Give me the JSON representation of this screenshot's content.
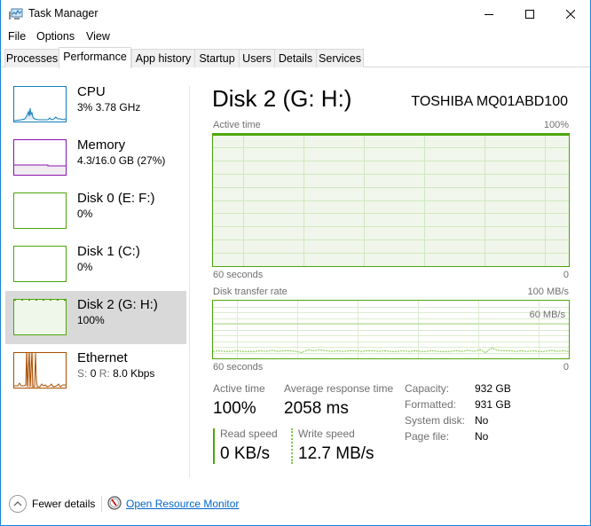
{
  "window": {
    "title": "Task Manager",
    "controls": {
      "minimize": "minimize",
      "maximize": "maximize",
      "close": "close"
    }
  },
  "menu": [
    "File",
    "Options",
    "View"
  ],
  "tabs": [
    {
      "label": "Processes",
      "active": false
    },
    {
      "label": "Performance",
      "active": true
    },
    {
      "label": "App history",
      "active": false
    },
    {
      "label": "Startup",
      "active": false
    },
    {
      "label": "Users",
      "active": false
    },
    {
      "label": "Details",
      "active": false
    },
    {
      "label": "Services",
      "active": false
    }
  ],
  "sidebar": {
    "items": [
      {
        "title": "CPU",
        "sub": "3%  3.78 GHz",
        "color": "#117dbb",
        "fill": "#f1f6fa",
        "selected": false
      },
      {
        "title": "Memory",
        "sub": "4.3/16.0 GB (27%)",
        "color": "#8b12ae",
        "fill": "#f4f2f4",
        "selected": false
      },
      {
        "title": "Disk 0 (E: F:)",
        "sub": "0%",
        "color": "#4da60c",
        "fill": "#ffffff",
        "selected": false
      },
      {
        "title": "Disk 1 (C:)",
        "sub": "0%",
        "color": "#4da60c",
        "fill": "#ffffff",
        "selected": false
      },
      {
        "title": "Disk 2 (G: H:)",
        "sub": "100%",
        "color": "#4da60c",
        "fill": "#eff6ea",
        "selected": true
      },
      {
        "title": "Ethernet",
        "sub_s_label": "S:",
        "sub_s_val": "0",
        "sub_r_label": "R:",
        "sub_r_val": "8.0 Kbps",
        "color": "#a74f01",
        "fill": "#ffffff",
        "selected": false
      }
    ]
  },
  "main": {
    "title": "Disk 2 (G: H:)",
    "model": "TOSHIBA MQ01ABD100",
    "active_graph": {
      "label": "Active time",
      "max_label": "100%",
      "x_left": "60 seconds",
      "x_right": "0",
      "value_percent": 100
    },
    "transfer_graph": {
      "label": "Disk transfer rate",
      "max_label": "100 MB/s",
      "marker_label": "60 MB/s",
      "x_left": "60 seconds",
      "x_right": "0",
      "write_series_mbps": [
        12,
        13,
        12,
        12,
        13,
        12,
        12,
        12,
        13,
        12,
        14,
        12,
        13,
        13,
        12,
        10,
        15,
        13,
        15,
        13,
        12,
        13,
        12,
        13,
        13,
        12,
        13,
        13,
        12,
        13,
        12,
        12,
        13,
        12,
        13,
        12,
        12,
        13,
        12,
        12,
        12,
        13,
        12,
        14,
        12,
        15,
        10,
        18,
        14,
        13,
        13,
        12,
        13,
        12,
        13,
        12,
        12,
        14,
        12,
        13,
        12
      ]
    },
    "stats": {
      "active_time_label": "Active time",
      "active_time_value": "100%",
      "avg_response_label": "Average response time",
      "avg_response_value": "2058 ms",
      "read_label": "Read speed",
      "read_value": "0 KB/s",
      "write_label": "Write speed",
      "write_value": "12.7 MB/s"
    },
    "info": [
      {
        "label": "Capacity:",
        "value": "932 GB"
      },
      {
        "label": "Formatted:",
        "value": "931 GB"
      },
      {
        "label": "System disk:",
        "value": "No"
      },
      {
        "label": "Page file:",
        "value": "No"
      }
    ]
  },
  "footer": {
    "fewer_details": "Fewer details",
    "resource_monitor": "Open Resource Monitor"
  },
  "colors": {
    "disk_accent": "#4da60c",
    "disk_fill": "#f0f6eb",
    "grid": "#d0e8c0",
    "window_border": "#1883d7",
    "link": "#0066cc"
  }
}
